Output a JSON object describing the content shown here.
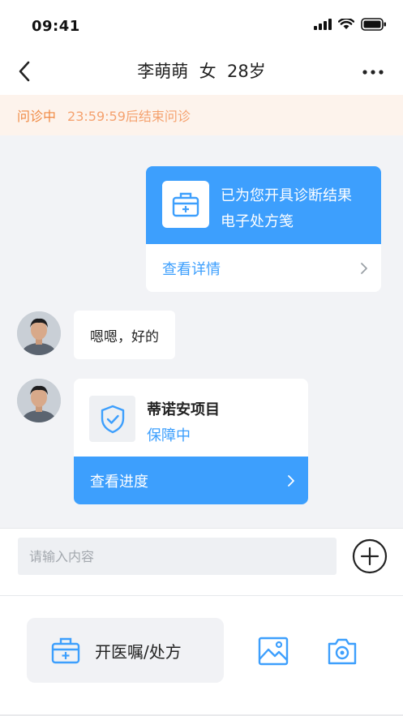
{
  "status_bar": {
    "time": "09:41"
  },
  "nav": {
    "title": "李萌萌  女  28岁"
  },
  "notice": {
    "status": "问诊中",
    "text": "23:59:59后结束问诊"
  },
  "messages": {
    "diagnosis_card": {
      "line1": "已为您开具诊断结果",
      "line2": "电子处方笺",
      "link": "查看详情"
    },
    "reply_text": "嗯嗯，好的",
    "insurance_card": {
      "name": "蒂诺安项目",
      "status": "保障中",
      "link": "查看进度"
    }
  },
  "composer": {
    "placeholder": "请输入内容"
  },
  "toolbar": {
    "prescription_label": "开医嘱/处方"
  },
  "colors": {
    "accent": "#3d9ffd",
    "notice": "#f08a44",
    "chat_bg": "#f2f3f6"
  },
  "icons": [
    "back-icon",
    "more-icon",
    "medical-kit-icon",
    "chevron-right-icon",
    "shield-check-icon",
    "plus-circle-icon",
    "image-icon",
    "camera-icon"
  ]
}
